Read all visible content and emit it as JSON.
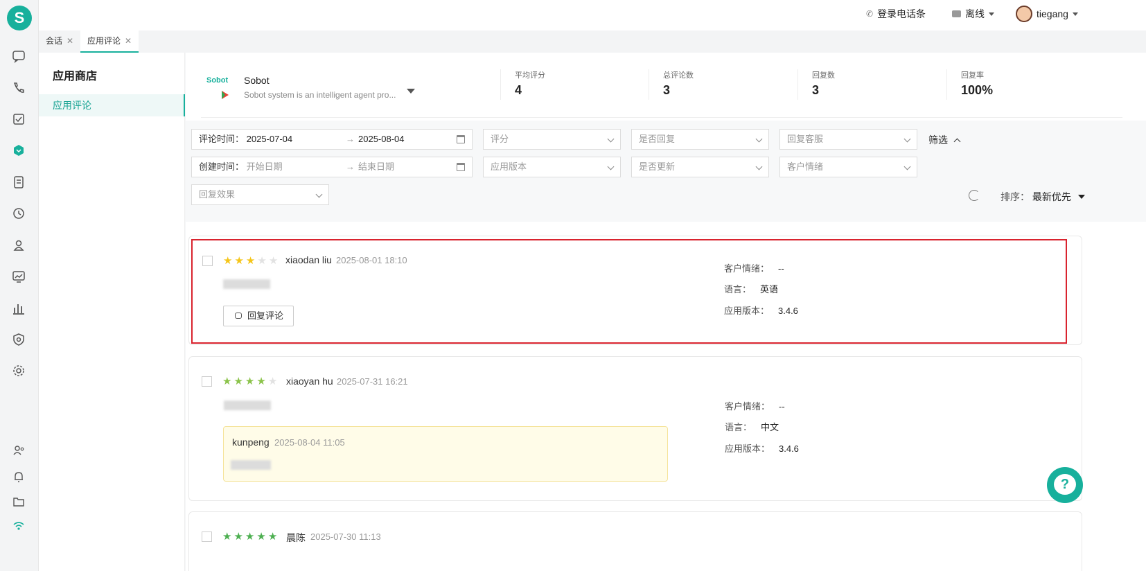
{
  "topbar": {
    "call_bar_label": "登录电话条",
    "status_label": "离线",
    "user_name": "tiegang"
  },
  "tabs": [
    {
      "label": "会话",
      "active": false
    },
    {
      "label": "应用评论",
      "active": true
    }
  ],
  "sidebar": {
    "title": "应用商店",
    "items": [
      {
        "label": "应用评论",
        "active": true
      }
    ]
  },
  "app": {
    "logo_text": "Sobot",
    "name": "Sobot",
    "description": "Sobot system is an intelligent agent pro..."
  },
  "stats": [
    {
      "label": "平均评分",
      "value": "4"
    },
    {
      "label": "总评论数",
      "value": "3"
    },
    {
      "label": "回复数",
      "value": "3"
    },
    {
      "label": "回复率",
      "value": "100%"
    }
  ],
  "filters": {
    "comment_time_label": "评论时间：",
    "comment_time_start": "2025-07-04",
    "comment_time_end": "2025-08-04",
    "create_time_label": "创建时间：",
    "create_start_placeholder": "开始日期",
    "create_end_placeholder": "结束日期",
    "rating_placeholder": "评分",
    "replied_placeholder": "是否回复",
    "reply_agent_placeholder": "回复客服",
    "app_version_placeholder": "应用版本",
    "updated_placeholder": "是否更新",
    "sentiment_placeholder": "客户情绪",
    "reply_effect_placeholder": "回复效果",
    "toggle_label": "筛选",
    "sort_label": "排序：",
    "sort_value": "最新优先"
  },
  "meta_labels": {
    "sentiment": "客户情绪：",
    "language": "语言：",
    "version": "应用版本："
  },
  "reply_button_label": "回复评论",
  "reviews": [
    {
      "rating": 3,
      "author": "xiaodan liu",
      "time": "2025-08-01 18:10",
      "sentiment": "--",
      "language": "英语",
      "version": "3.4.6",
      "star_color": "#f5c518"
    },
    {
      "rating": 4,
      "author": "xiaoyan hu",
      "time": "2025-07-31 16:21",
      "sentiment": "--",
      "language": "中文",
      "version": "3.4.6",
      "star_color": "#8bc34a",
      "reply": {
        "author": "kunpeng",
        "time": "2025-08-04 11:05"
      }
    },
    {
      "rating": 5,
      "author": "晨陈",
      "time": "2025-07-30 11:13",
      "star_color": "#4caf50"
    }
  ],
  "colors": {
    "accent": "#17b09c",
    "highlight_border": "#d9232e"
  }
}
